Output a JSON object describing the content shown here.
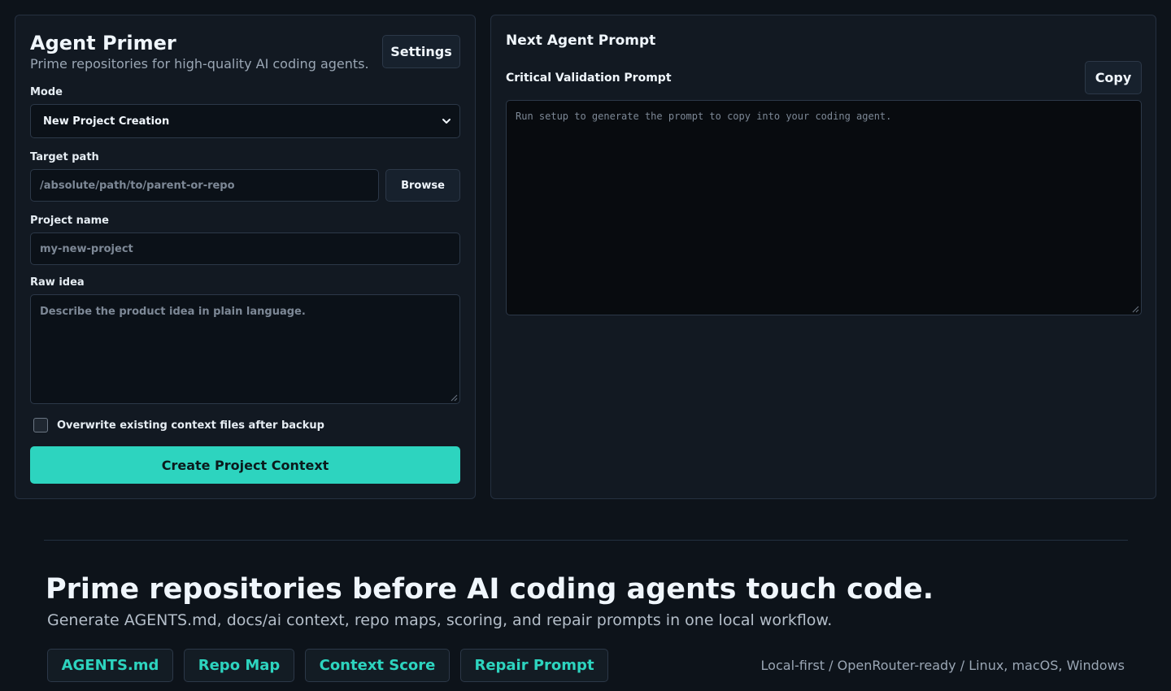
{
  "left_panel": {
    "title": "Agent Primer",
    "subtitle": "Prime repositories for high-quality AI coding agents.",
    "settings_label": "Settings",
    "mode": {
      "label": "Mode",
      "selected": "New Project Creation",
      "icon": "chevron-down-icon"
    },
    "target_path": {
      "label": "Target path",
      "placeholder": "/absolute/path/to/parent-or-repo",
      "browse_label": "Browse"
    },
    "project_name": {
      "label": "Project name",
      "placeholder": "my-new-project"
    },
    "raw_idea": {
      "label": "Raw idea",
      "placeholder": "Describe the product idea in plain language."
    },
    "overwrite": {
      "label": "Overwrite existing context files after backup",
      "checked": false
    },
    "create_label": "Create Project Context"
  },
  "right_panel": {
    "title": "Next Agent Prompt",
    "prompt_label": "Critical Validation Prompt",
    "copy_label": "Copy",
    "prompt_placeholder": "Run setup to generate the prompt to copy into your coding agent."
  },
  "hero": {
    "title": "Prime repositories before AI coding agents touch code.",
    "subtitle": "Generate AGENTS.md, docs/ai context, repo maps, scoring, and repair prompts in one local workflow.",
    "chips": [
      "AGENTS.md",
      "Repo Map",
      "Context Score",
      "Repair Prompt"
    ],
    "platform_note": "Local-first / OpenRouter-ready / Linux, macOS, Windows"
  },
  "colors": {
    "accent": "#2dd4bf",
    "background": "#0d131a",
    "panel": "#121922",
    "border": "#253040"
  }
}
